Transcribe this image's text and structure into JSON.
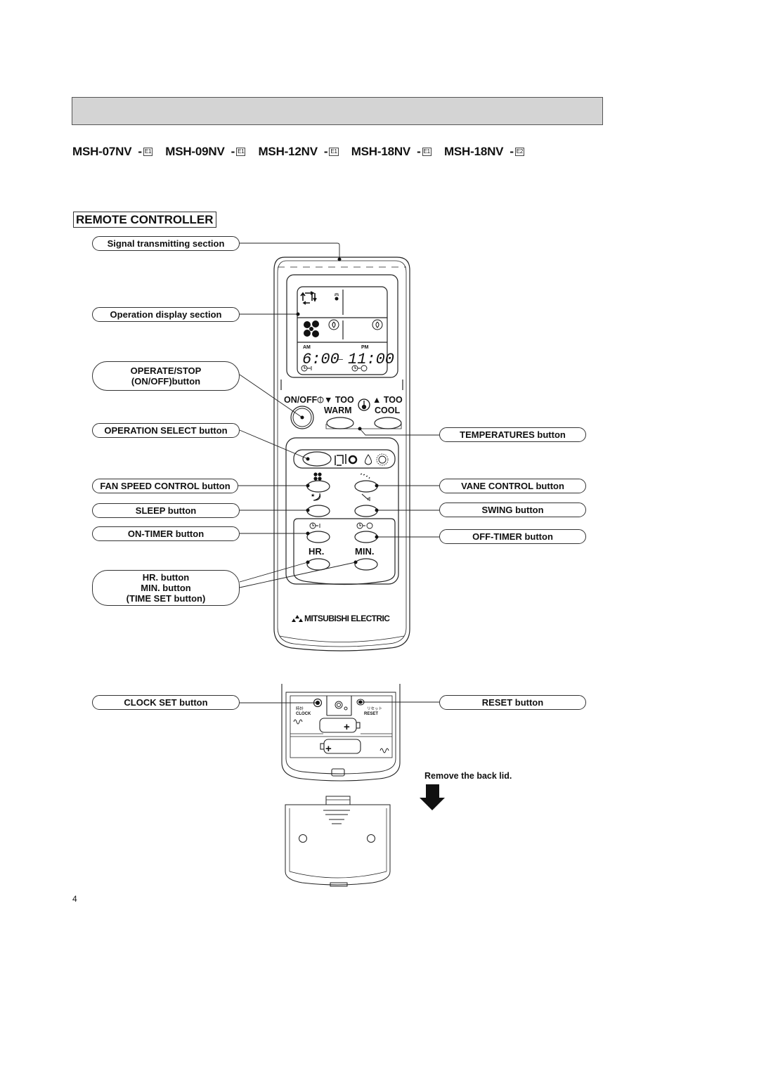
{
  "header": {
    "bar_label": ""
  },
  "models": [
    {
      "name": "MSH-07NV",
      "suffix": "E1"
    },
    {
      "name": "MSH-09NV",
      "suffix": "E1"
    },
    {
      "name": "MSH-12NV",
      "suffix": "E1"
    },
    {
      "name": "MSH-18NV",
      "suffix": "E1"
    },
    {
      "name": "MSH-18NV",
      "suffix": "E2"
    }
  ],
  "section_title": "REMOTE CONTROLLER",
  "callouts_left": {
    "signal": "Signal transmitting section",
    "display": "Operation display section",
    "operate_line1": "OPERATE/STOP",
    "operate_line2": "(ON/OFF)button",
    "op_select": "OPERATION SELECT button",
    "fan_speed": "FAN SPEED CONTROL button",
    "sleep": "SLEEP button",
    "on_timer": "ON-TIMER button",
    "time_line1": "HR. button",
    "time_line2": "MIN. button",
    "time_line3": "(TIME SET button)",
    "clock_set": "CLOCK SET button"
  },
  "callouts_right": {
    "temperatures": "TEMPERATURES button",
    "vane": "VANE CONTROL button",
    "swing": "SWING button",
    "off_timer": "OFF-TIMER button",
    "reset": "RESET button"
  },
  "remote": {
    "lcd": {
      "am": "AM",
      "pm": "PM",
      "on_time": "6:00",
      "off_time": "11:00",
      "arrow": "←"
    },
    "onoff_label": "ON/OFF",
    "too_warm_1": "▼ TOO",
    "too_warm_2": "WARM",
    "too_cool_1": "▲ TOO",
    "too_cool_2": "COOL",
    "hr_label": "HR.",
    "min_label": "MIN.",
    "brand": "MITSUBISHI ELECTRIC",
    "clock_jp": "時計",
    "clock_en": "CLOCK",
    "reset_jp": "リセット",
    "reset_en": "RESET"
  },
  "instruction": "Remove the back lid.",
  "page_number": "4",
  "colors": {
    "header_bar": "#d4d4d4",
    "ink": "#111111"
  }
}
